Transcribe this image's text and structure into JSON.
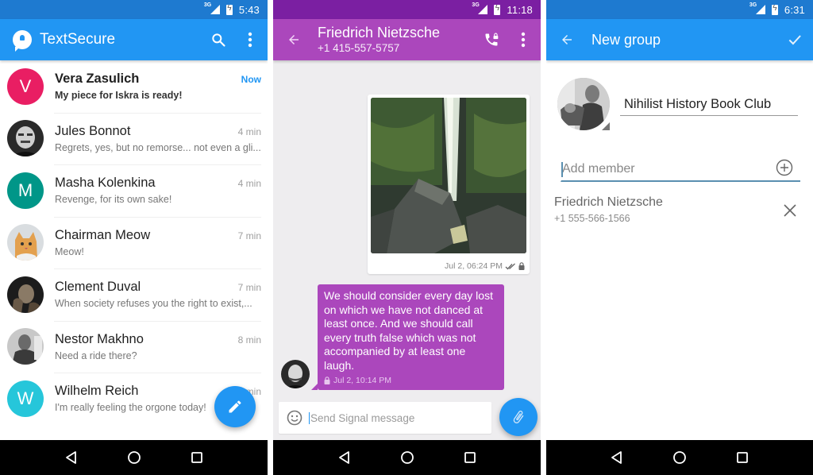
{
  "screens": {
    "inbox": {
      "status_time": "5:43",
      "network": "3G",
      "app_title": "TextSecure",
      "colors": {
        "primary": "#2196f3",
        "status_bar": "#1e7ad0"
      },
      "conversations": [
        {
          "name": "Vera Zasulich",
          "snippet": "My piece for Iskra is ready!",
          "time": "Now",
          "avatar_letter": "V",
          "avatar_color": "#e91e63",
          "unread": true
        },
        {
          "name": "Jules Bonnot",
          "snippet": "Regrets, yes, but no remorse... not even a gli...",
          "time": "4 min",
          "avatar_photo": "portrait-photo"
        },
        {
          "name": "Masha Kolenkina",
          "snippet": "Revenge, for its own sake!",
          "time": "4 min",
          "avatar_letter": "M",
          "avatar_color": "#009688"
        },
        {
          "name": "Chairman Meow",
          "snippet": "Meow!",
          "time": "7 min",
          "avatar_photo": "cat-photo"
        },
        {
          "name": "Clement Duval",
          "snippet": "When society refuses you the right to exist,...",
          "time": "7 min",
          "avatar_photo": "portrait-photo"
        },
        {
          "name": "Nestor Makhno",
          "snippet": "Need a ride there?",
          "time": "8 min",
          "avatar_photo": "portrait-photo"
        },
        {
          "name": "Wilhelm Reich",
          "snippet": "I'm really feeling the orgone today!",
          "time": "min",
          "avatar_letter": "W",
          "avatar_color": "#26c6da"
        }
      ],
      "icons": {
        "search": "search-icon",
        "more": "more-vert-icon",
        "compose": "pencil-icon"
      }
    },
    "conversation": {
      "status_time": "11:18",
      "network": "3G",
      "contact_name": "Friedrich Nietzsche",
      "contact_number": "+1 415-557-5757",
      "colors": {
        "primary": "#ab47bc",
        "status_bar": "#7b1fa2"
      },
      "messages": [
        {
          "direction": "outgoing",
          "type": "image",
          "image": "waterfall-photo",
          "timestamp": "Jul 2, 06:24 PM",
          "delivered": true,
          "secure": true
        },
        {
          "direction": "incoming",
          "type": "text",
          "text": "We should consider every day lost on which we have not danced at least once. And we should call every truth false which was not accompanied by at least one laugh.",
          "timestamp": "Jul 2, 10:14 PM",
          "secure": true
        }
      ],
      "composer_placeholder": "Send Signal message",
      "icons": {
        "back": "arrow-back-icon",
        "call": "secure-call-icon",
        "more": "more-vert-icon",
        "emoji": "emoji-icon",
        "attach": "paperclip-icon"
      }
    },
    "new_group": {
      "status_time": "6:31",
      "network": "3G",
      "title": "New group",
      "group_name": "Nihilist History Book Club",
      "add_member_placeholder": "Add member",
      "members": [
        {
          "name": "Friedrich Nietzsche",
          "number": "+1 555-566-1566"
        }
      ],
      "colors": {
        "primary": "#2196f3",
        "status_bar": "#1e7ad0"
      },
      "icons": {
        "back": "arrow-back-icon",
        "confirm": "check-icon",
        "add": "add-circle-icon",
        "remove": "close-icon"
      }
    }
  }
}
